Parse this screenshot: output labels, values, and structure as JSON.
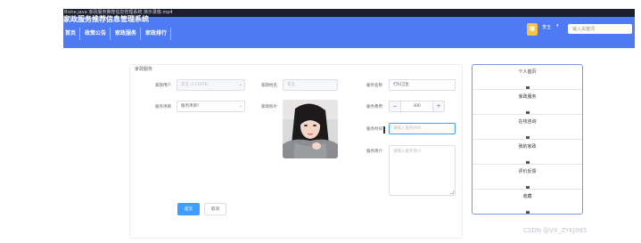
{
  "header": {
    "video_title": "Bishe.java 家政服务推荐信息管理系统 演示录像.mp4",
    "app_title": "家政服务推荐信息管理系统",
    "nav": [
      "首页",
      "政策公告",
      "家政服务",
      "家政排行"
    ],
    "username": "李玉",
    "user_caret": "▾",
    "search_placeholder": "输入关键词"
  },
  "form": {
    "title": "家政服务",
    "fields": {
      "user_label": "家政用户",
      "user_value": "李玉 (123456)",
      "name_label": "家政姓名",
      "name_value": "李玉",
      "service_name_label": "服务名称",
      "service_name_value": "打扫卫生",
      "project_label": "服务项目",
      "project_placeholder": "服务项目?",
      "photo_label": "家政照片",
      "fee_label": "服务费用",
      "fee_minus": "−",
      "fee_value": "300",
      "fee_plus": "+",
      "time_label": "服务时间",
      "time_placeholder": "请输入服务时间",
      "intro_label": "服务简介",
      "intro_placeholder": "请输入服务简介"
    },
    "submit_label": "提交",
    "cancel_label": "取消"
  },
  "sidebar": {
    "items": [
      {
        "label": "个人首页"
      },
      {
        "label": "家政服务"
      },
      {
        "label": "在线咨询"
      },
      {
        "label": "我的家政"
      },
      {
        "label": "评价反馈"
      },
      {
        "label": "收藏"
      }
    ]
  },
  "watermark": "CSDN @VX_ZYKJ985",
  "colors": {
    "header_blue": "#4e7af3",
    "primary": "#409eff",
    "sidebar_border": "#7b93e8"
  }
}
